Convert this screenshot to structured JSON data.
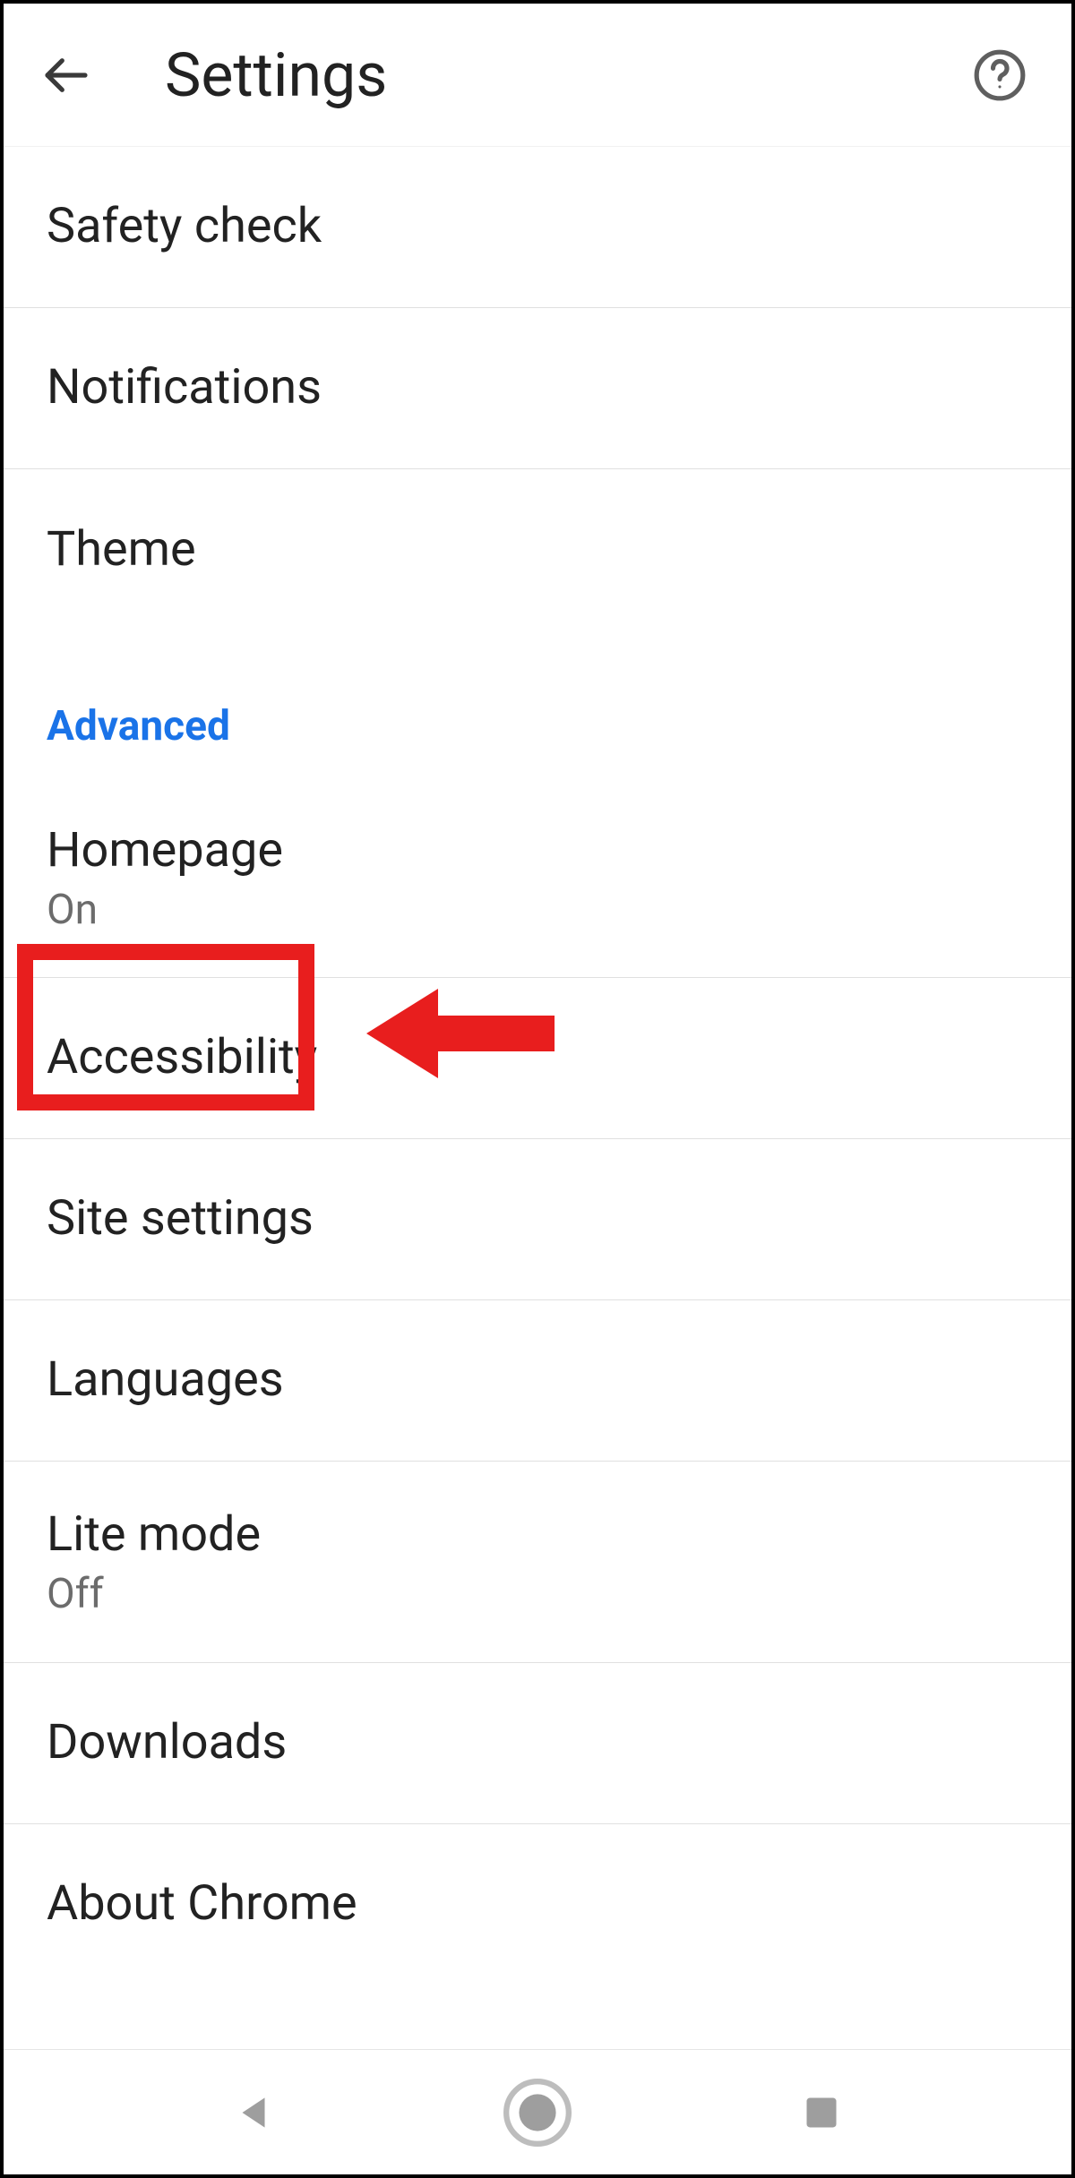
{
  "header": {
    "title": "Settings"
  },
  "sections": [
    {
      "items": [
        {
          "label": "Safety check"
        },
        {
          "label": "Notifications"
        },
        {
          "label": "Theme"
        }
      ]
    },
    {
      "title": "Advanced",
      "items": [
        {
          "label": "Homepage",
          "sub": "On",
          "highlighted": true
        },
        {
          "label": "Accessibility"
        },
        {
          "label": "Site settings"
        },
        {
          "label": "Languages"
        },
        {
          "label": "Lite mode",
          "sub": "Off"
        },
        {
          "label": "Downloads"
        },
        {
          "label": "About Chrome"
        }
      ]
    }
  ],
  "icons": {
    "back": "back-arrow-icon",
    "help": "help-circle-icon",
    "nav_back": "nav-back-icon",
    "nav_home": "nav-home-icon",
    "nav_recents": "nav-recents-icon"
  },
  "annotation": {
    "highlight_color": "#e81e1e"
  }
}
